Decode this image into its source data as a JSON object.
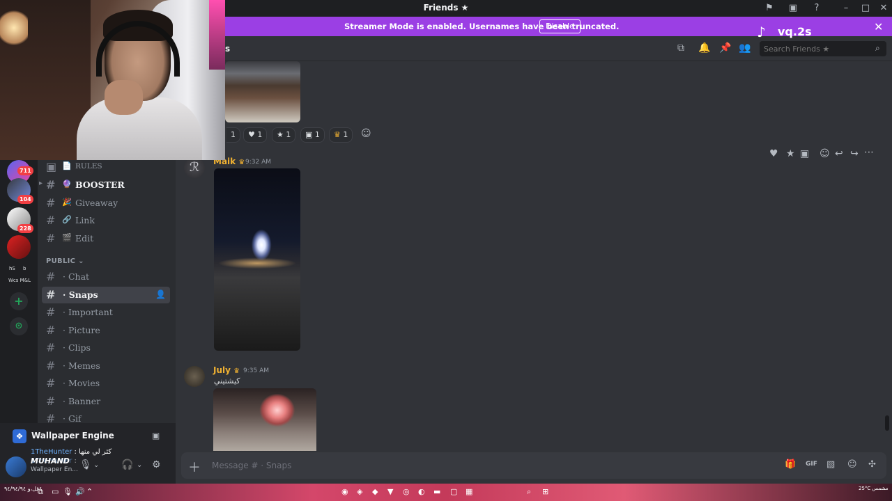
{
  "window": {
    "title": "Friends ★",
    "icons": [
      "flag-icon",
      "inbox-icon",
      "help-icon",
      "minimize-icon",
      "maximize-icon",
      "close-icon"
    ]
  },
  "banner": {
    "message": "Streamer Mode is enabled. Usernames have been truncated.",
    "disable_label": "Disable"
  },
  "overlay": {
    "tiktok_handle": "vq.2s"
  },
  "rail": {
    "badges": [
      "711",
      "104",
      "228"
    ],
    "labels": [
      "hS",
      "b",
      "Wcs M&L"
    ]
  },
  "channels": {
    "top_items": [
      {
        "label": "RULES",
        "emoji": "📄"
      },
      {
        "label": "BOOSTER",
        "emoji": "🔮"
      },
      {
        "label": "Giveaway",
        "emoji": "🎉"
      },
      {
        "label": "Link",
        "emoji": "🔗"
      },
      {
        "label": "Edit",
        "emoji": "🎬"
      }
    ],
    "category": "PUBLIC",
    "public_items": [
      "Chat",
      "Snaps",
      "Important",
      "Picture",
      "Clips",
      "Memes",
      "Movies",
      "Banner",
      "Gif"
    ]
  },
  "activity": {
    "app": "Wallpaper Engine"
  },
  "chat_overlay": [
    {
      "user": "1TheHunter",
      "text": "كثر لي منها"
    },
    {
      "user": "1TheHunter",
      "text": ""
    }
  ],
  "user": {
    "name": "MUHAND",
    "status": "Wallpaper En..."
  },
  "header": {
    "channel_name": "s",
    "search_placeholder": "Search Friends ★"
  },
  "reactions": [
    {
      "emoji": "",
      "count": "1"
    },
    {
      "emoji": "♥",
      "count": "1"
    },
    {
      "emoji": "★",
      "count": "1"
    },
    {
      "emoji": "▣",
      "count": "1"
    },
    {
      "emoji": "♛",
      "count": "1"
    }
  ],
  "messages": [
    {
      "author": "Maik",
      "author_color": "#f0b132",
      "crown": "♛",
      "time": "9:32 AM",
      "text": ""
    },
    {
      "author": "July",
      "author_color": "#f0b132",
      "crown": "♛",
      "time": "9:35 AM",
      "text": "كيشتيني"
    }
  ],
  "composer": {
    "placeholder": "Message # · Snaps"
  },
  "taskbar": {
    "left_text": "٤قل،و ٩٤/٩٤/٩٤",
    "right_text": "25°C مشمس"
  }
}
